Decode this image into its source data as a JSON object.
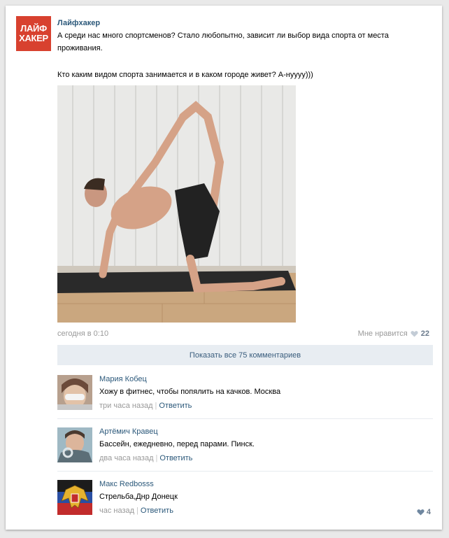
{
  "post": {
    "author": "Лайфхакер",
    "logo_line1": "ЛАЙФ",
    "logo_line2": "ХАКЕР",
    "text_line1": "А среди нас много спортсменов? Стало любопытно, зависит ли выбор вида спорта от места",
    "text_line2": "проживания.",
    "text_line3": "Кто каким видом спорта занимается и в каком городе живет? А-нуууу)))",
    "time": "сегодня в 0:10",
    "like_label": "Мне нравится",
    "like_count": "22",
    "show_all_comments": "Показать все 75 комментариев"
  },
  "comments": [
    {
      "name": "Мария Кобец",
      "text": "Хожу в фитнес, чтобы попялить на качков. Москва",
      "time": "три часа назад",
      "reply": "Ответить"
    },
    {
      "name": "Артёмич Кравец",
      "text": "Бассейн, ежедневно, перед парами. Пинск.",
      "time": "два часа назад",
      "reply": "Ответить"
    },
    {
      "name": "Макс Redbosss",
      "text": "Стрельба,Днр Донецк",
      "time": "час назад",
      "reply": "Ответить",
      "like_count": "4"
    }
  ],
  "colors": {
    "brand": "#d8412f",
    "link": "#2b587a",
    "muted": "#999999",
    "show_all_bg": "#e8edf2"
  },
  "icons": [
    "heart-icon"
  ]
}
